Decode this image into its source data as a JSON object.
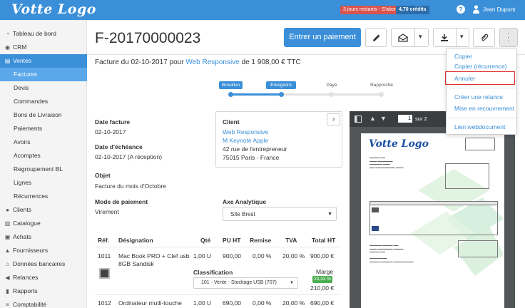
{
  "topbar": {
    "logo": "Votte Logo",
    "trial_badge": "3 jours restants - S'abonner",
    "credits": "4,70 crédits",
    "help": "?",
    "user": "Jean Dupont"
  },
  "sidebar": {
    "items": [
      {
        "label": "Tableau de bord",
        "icon": "dashboard-icon"
      },
      {
        "label": "CRM",
        "icon": "crm-icon"
      },
      {
        "label": "Ventes",
        "icon": "cart-icon"
      },
      {
        "label": "Factures"
      },
      {
        "label": "Devis"
      },
      {
        "label": "Commandes"
      },
      {
        "label": "Bons de Livraison"
      },
      {
        "label": "Paiements"
      },
      {
        "label": "Avoirs"
      },
      {
        "label": "Acomptes"
      },
      {
        "label": "Regroupement BL"
      },
      {
        "label": "Lignes"
      },
      {
        "label": "Récurrences"
      },
      {
        "label": "Clients",
        "icon": "users-icon"
      },
      {
        "label": "Catalogue",
        "icon": "catalog-icon"
      },
      {
        "label": "Achats",
        "icon": "bag-icon"
      },
      {
        "label": "Fournisseurs",
        "icon": "supplier-icon"
      },
      {
        "label": "Données bancaires",
        "icon": "bank-icon"
      },
      {
        "label": "Relances",
        "icon": "megaphone-icon"
      },
      {
        "label": "Rapports",
        "icon": "chart-icon"
      },
      {
        "label": "Comptabilité",
        "icon": "accounting-icon"
      }
    ]
  },
  "header": {
    "title": "F-20170000023",
    "primary_button": "Entrer un paiement",
    "subtitle_prefix": "Facture du 02-10-2017 pour",
    "subtitle_client": "Web Responsive",
    "subtitle_suffix": "de 1 908,00 € TTC"
  },
  "status_steps": [
    {
      "label": "Brouillon",
      "done": true
    },
    {
      "label": "Enregistré",
      "done": true
    },
    {
      "label": "Payé",
      "done": false
    },
    {
      "label": "Rapproché",
      "done": false
    }
  ],
  "invoice": {
    "date_label": "Date facture",
    "date_value": "02-10-2017",
    "due_label": "Date d'échéance",
    "due_value": "02-10-2017 (A réception)",
    "object_label": "Objet",
    "object_value": "Facture du mois d'Octobre",
    "payment_label": "Mode de paiement",
    "payment_value": "Virement",
    "analytic_label": "Axe Analytique",
    "analytic_value": "Site Brest"
  },
  "client": {
    "label": "Client",
    "name": "Web Responsive",
    "contact": "M Keynote Apple",
    "address1": "42 rue de l'entrepreneur",
    "address2": "75015 Paris - France"
  },
  "table": {
    "headers": [
      "Réf.",
      "Désignation",
      "Qté",
      "PU HT",
      "Remise",
      "TVA",
      "Total HT"
    ],
    "rows": [
      {
        "ref": "1011",
        "designation_1": "Mac Book PRO + Clef usb",
        "designation_2": "8GB Sandisk",
        "qty": "1,00 U",
        "pu": "900,00",
        "remise": "0,00 %",
        "tva": "20,00 %",
        "total": "900,00 €",
        "classification_label": "Classification",
        "classification_value": "101 - Vente - Stockage USB (707)",
        "marge_label": "Marge",
        "marge_pct": "23,33 %",
        "marge_value": "210,00 €"
      },
      {
        "ref": "1012",
        "designation_1": "Ordinateur mutli-touche",
        "qty": "1,00 U",
        "pu": "690,00",
        "remise": "0,00 %",
        "tva": "20,00 %",
        "total": "690,00 €"
      }
    ]
  },
  "pdf_viewer": {
    "page": "1",
    "of": "sur 2",
    "doc_logo": "Votte Logo"
  },
  "menu": {
    "items": [
      "Copier",
      "Copier (récurrence)",
      "Annuler",
      "Créer une relance",
      "Mise en recouvrement",
      "Lien webdocument"
    ]
  },
  "colors": {
    "brand": "#3a8fd8",
    "active": "#5aa8ea",
    "trial": "#d9534f",
    "highlight": "#e03030",
    "marge": "#4caf50"
  }
}
